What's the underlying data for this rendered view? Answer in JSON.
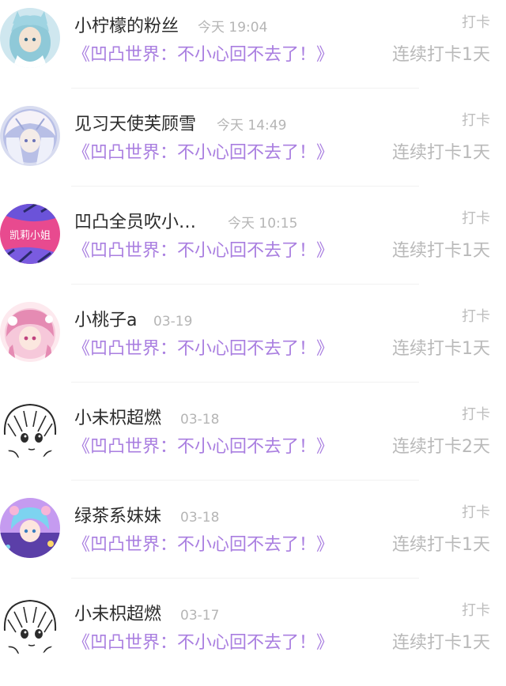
{
  "checkins": [
    {
      "username": "小柠檬的粉丝",
      "time": "今天 19:04",
      "work_title": "《凹凸世界：不小心回不去了！》",
      "checkin_label": "打卡",
      "streak": "连续打卡1天",
      "avatar_icon": "anime-avatar-blue-hair-icon",
      "avatar_colors": [
        "#cfe7ef",
        "#8fc9d8",
        "#f3e3d3"
      ]
    },
    {
      "username": "见习天使芙顾雪",
      "time": "今天 14:49",
      "work_title": "《凹凸世界：不小心回不去了！》",
      "checkin_label": "打卡",
      "streak": "连续打卡1天",
      "avatar_icon": "anime-avatar-white-hair-icon",
      "avatar_colors": [
        "#d8dcf0",
        "#9ea7d6",
        "#f6f2f8"
      ]
    },
    {
      "username": "凹凸全员吹小…",
      "time": "今天 10:15",
      "work_title": "《凹凸世界：不小心回不去了！》",
      "checkin_label": "打卡",
      "streak": "连续打卡1天",
      "avatar_icon": "pink-logo-avatar-icon",
      "avatar_text": "凯莉小姐",
      "avatar_colors": [
        "#e84a8f",
        "#6b53d9",
        "#ffffff"
      ]
    },
    {
      "username": "小桃子a",
      "time": "03-19",
      "work_title": "《凹凸世界：不小心回不去了！》",
      "checkin_label": "打卡",
      "streak": "连续打卡1天",
      "avatar_icon": "anime-avatar-pink-hair-icon",
      "avatar_colors": [
        "#f6c8da",
        "#e58bb3",
        "#fde9ee"
      ]
    },
    {
      "username": "小未枳超燃",
      "time": "03-18",
      "work_title": "《凹凸世界：不小心回不去了！》",
      "checkin_label": "打卡",
      "streak": "连续打卡2天",
      "avatar_icon": "manga-sketch-avatar-icon",
      "avatar_colors": [
        "#ffffff",
        "#2b2b2b",
        "#e8e8e8"
      ]
    },
    {
      "username": "绿茶系妹妹",
      "time": "03-18",
      "work_title": "《凹凸世界：不小心回不去了！》",
      "checkin_label": "打卡",
      "streak": "连续打卡1天",
      "avatar_icon": "anime-avatar-colorful-icon",
      "avatar_colors": [
        "#7dd3f0",
        "#c59bf0",
        "#f7b6d8"
      ]
    },
    {
      "username": "小未枳超燃",
      "time": "03-17",
      "work_title": "《凹凸世界：不小心回不去了！》",
      "checkin_label": "打卡",
      "streak": "连续打卡1天",
      "avatar_icon": "manga-sketch-avatar-icon",
      "avatar_colors": [
        "#ffffff",
        "#2b2b2b",
        "#e8e8e8"
      ]
    }
  ]
}
